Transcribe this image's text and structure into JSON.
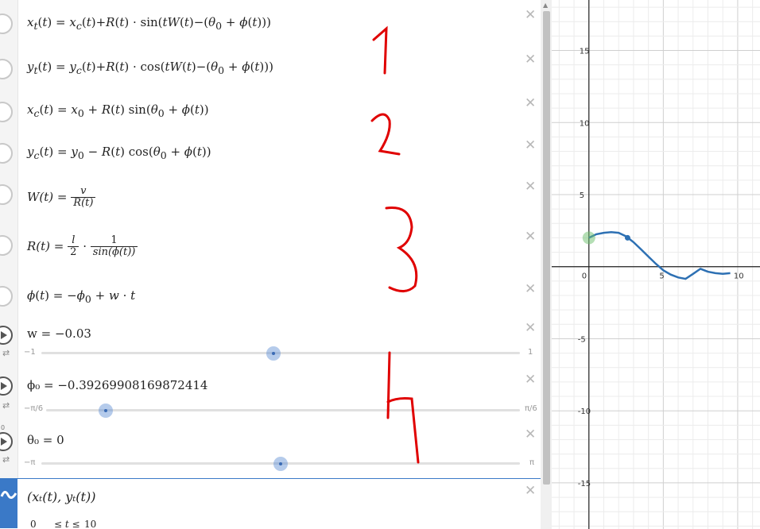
{
  "expressions": [
    {
      "id": "xt",
      "html": "<i>x<sub>t</sub></i>(<i>t</i>) = <i>x<sub>c</sub></i>(<i>t</i>)+<i>R</i>(<i>t</i>) · sin(<i>tW</i>(<i>t</i>)−(<i>θ</i><sub>0</sub> + <i>ϕ</i>(<i>t</i>)))"
    },
    {
      "id": "yt",
      "html": "<i>y<sub>t</sub></i>(<i>t</i>) = <i>y<sub>c</sub></i>(<i>t</i>)+<i>R</i>(<i>t</i>) · cos(<i>tW</i>(<i>t</i>)−(<i>θ</i><sub>0</sub> + <i>ϕ</i>(<i>t</i>)))"
    },
    {
      "id": "xc",
      "html": "<i>x<sub>c</sub></i>(<i>t</i>) = <i>x</i><sub>0</sub> + <i>R</i>(<i>t</i>) sin(<i>θ</i><sub>0</sub> + <i>ϕ</i>(<i>t</i>))"
    },
    {
      "id": "yc",
      "html": "<i>y<sub>c</sub></i>(<i>t</i>) = <i>y</i><sub>0</sub> − <i>R</i>(<i>t</i>) cos(<i>θ</i><sub>0</sub> + <i>ϕ</i>(<i>t</i>))"
    },
    {
      "id": "W",
      "lhs": "W(t) =",
      "num": "v",
      "den": "R(t)"
    },
    {
      "id": "R",
      "lhs": "R(t) =",
      "num": "l",
      "den": "2",
      "mid": "·",
      "num2": "1",
      "den2": "sin(ϕ(t))"
    },
    {
      "id": "phi",
      "html": "<i>ϕ</i>(<i>t</i>) = −<i>ϕ</i><sub>0</sub> + <i>w</i> · <i>t</i>"
    }
  ],
  "sliders": [
    {
      "id": "w",
      "label": "w = −0.03",
      "min": "−1",
      "max": "1",
      "value": -0.03,
      "range": [
        -1,
        1
      ]
    },
    {
      "id": "phi0",
      "label": "ϕ₀ = −0.39269908169872414",
      "min": "−π/6",
      "max": "π/6",
      "value": -0.39269908169872414,
      "range": [
        -0.5235987756,
        0.5235987756
      ]
    },
    {
      "id": "theta0",
      "label": "θ₀ = 0",
      "min": "−π",
      "max": "π",
      "value": 0,
      "range": [
        -3.14159265,
        3.14159265
      ]
    }
  ],
  "parametric": {
    "label": "(xₜ(t), yₜ(t))",
    "tmin": "0",
    "tmax": "10",
    "range_label": "≤ t ≤"
  },
  "close_glyph": "✕",
  "annotations": [
    "1",
    "2",
    "3",
    "4"
  ],
  "colors": {
    "curve": "#2d70b3",
    "point_green": "#6bbf6b",
    "annotation": "#e00000",
    "icon_blue": "#3a79c7"
  },
  "chart_data": {
    "type": "line",
    "x_ticks": [
      "0",
      "5",
      "10"
    ],
    "y_ticks": [
      "15",
      "10",
      "5",
      "-5",
      "-10",
      "-15"
    ],
    "xlim": [
      -2.5,
      11.5
    ],
    "ylim": [
      -18.2,
      18.5
    ],
    "grid": true,
    "series": [
      {
        "values_x": [
          0,
          0.5,
          1,
          1.5,
          2,
          2.5,
          3,
          3.5,
          4,
          4.5,
          5,
          5.5,
          6,
          6.5,
          7,
          7.5,
          8,
          8.5,
          9,
          9.5
        ],
        "values_y": [
          2.0,
          2.25,
          2.35,
          2.4,
          2.35,
          2.1,
          1.7,
          1.2,
          0.7,
          0.2,
          -0.25,
          -0.55,
          -0.75,
          -0.85,
          -0.5,
          -0.15,
          -0.35,
          -0.45,
          -0.5,
          -0.45
        ]
      }
    ],
    "points": [
      {
        "x": 0,
        "y": 2.0,
        "color": "#6bbf6b"
      },
      {
        "x": 2.6,
        "y": 2.0,
        "color": "#2d70b3"
      }
    ]
  }
}
